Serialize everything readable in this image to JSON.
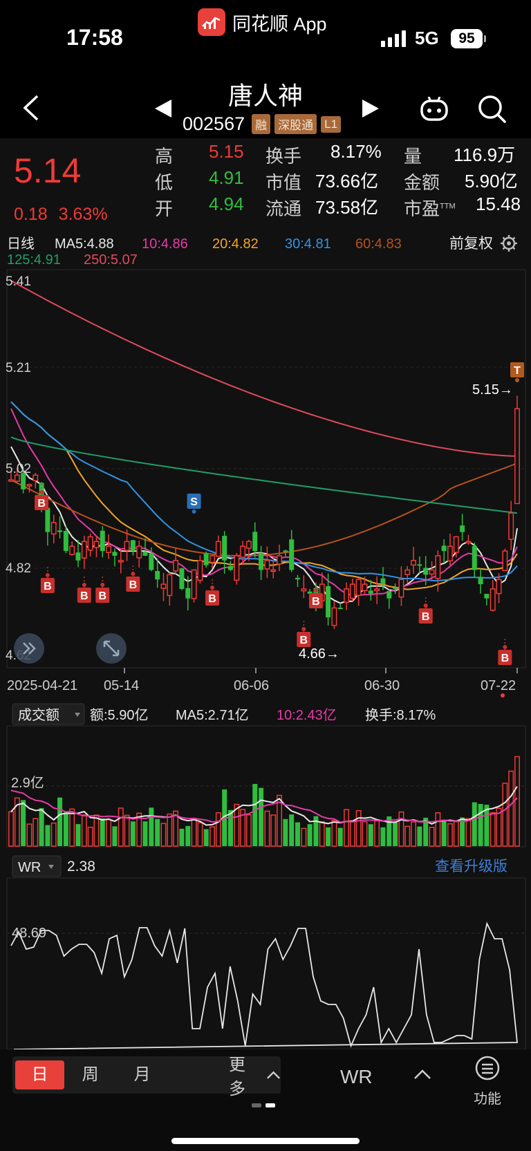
{
  "status": {
    "time": "17:58",
    "app": "同花顺 App",
    "network": "5G",
    "battery": "95"
  },
  "header": {
    "name": "唐人神",
    "code": "002567",
    "tags": [
      "融",
      "深股通",
      "L1"
    ]
  },
  "quote": {
    "price": "5.14",
    "change": "0.18",
    "change_pct": "3.63%",
    "high_label": "高",
    "high": "5.15",
    "low_label": "低",
    "low": "4.91",
    "open_label": "开",
    "open": "4.94",
    "turnover_label": "换手",
    "turnover": "8.17%",
    "mktcap_label": "市值",
    "mktcap": "73.66亿",
    "float_label": "流通",
    "float": "73.58亿",
    "volume_label": "量",
    "volume": "116.9万",
    "amount_label": "金额",
    "amount": "5.90亿",
    "pe_label": "市盈",
    "pe_sup": "TTM",
    "pe": "15.48"
  },
  "kline_header": {
    "period": "日线",
    "ma5": "MA5:4.88",
    "ma10": "10:4.86",
    "ma20": "20:4.82",
    "ma30": "30:4.81",
    "ma60": "60:4.83",
    "ma125": "125:4.91",
    "ma250": "250:5.07",
    "adjust": "前复权"
  },
  "colors": {
    "up": "#ef3b37",
    "down": "#2fbd3f",
    "ma5": "#e8e8e8",
    "ma10": "#e83aa8",
    "ma20": "#f2a62a",
    "ma30": "#2f95e8",
    "ma60": "#b8521e",
    "ma125": "#1f9e6a",
    "ma250": "#e04a5e"
  },
  "price_axis": {
    "ticks": [
      "5.41",
      "5.21",
      "5.02",
      "4.82",
      "4.62"
    ]
  },
  "date_axis": {
    "ticks": [
      "2025-04-21",
      "05-14",
      "06-06",
      "06-30",
      "07-22"
    ]
  },
  "annotations": {
    "high_label": "5.15→",
    "low_label": "4.66→",
    "b": "B",
    "s": "S",
    "t": "T"
  },
  "volume_header": {
    "selector": "成交额",
    "amount": "额:5.90亿",
    "ma5": "MA5:2.71亿",
    "ma10": "10:2.43亿",
    "turnover": "换手:8.17%",
    "axis_label": "2.9亿"
  },
  "wr_header": {
    "selector": "WR",
    "value": "2.38",
    "upgrade": "查看升级版",
    "axis_label": "48.69"
  },
  "bottom": {
    "tabs": [
      "日",
      "周",
      "月"
    ],
    "more": "更多",
    "indicator": "WR",
    "func": "功能"
  }
}
